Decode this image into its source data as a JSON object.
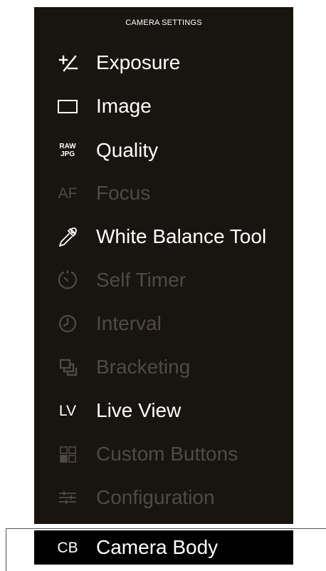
{
  "panel": {
    "title": "CAMERA SETTINGS"
  },
  "menu": [
    {
      "label": "Exposure",
      "icon": "exposure-compensation-icon",
      "icon_text": "",
      "enabled": true
    },
    {
      "label": "Image",
      "icon": "image-frame-icon",
      "icon_text": "",
      "enabled": true
    },
    {
      "label": "Quality",
      "icon": "raw-jpg-icon",
      "icon_text_top": "RAW",
      "icon_text_bottom": "JPG",
      "enabled": true
    },
    {
      "label": "Focus",
      "icon": "af-icon",
      "icon_text": "AF",
      "enabled": false
    },
    {
      "label": "White Balance Tool",
      "icon": "eyedropper-icon",
      "icon_text": "",
      "enabled": true
    },
    {
      "label": "Self Timer",
      "icon": "self-timer-icon",
      "icon_text": "",
      "enabled": false
    },
    {
      "label": "Interval",
      "icon": "interval-clock-icon",
      "icon_text": "",
      "enabled": false
    },
    {
      "label": "Bracketing",
      "icon": "bracketing-icon",
      "icon_text": "",
      "enabled": false
    },
    {
      "label": "Live View",
      "icon": "lv-icon",
      "icon_text": "LV",
      "enabled": true
    },
    {
      "label": "Custom Buttons",
      "icon": "custom-buttons-grid-icon",
      "icon_text": "",
      "enabled": false
    },
    {
      "label": "Configuration",
      "icon": "sliders-icon",
      "icon_text": "",
      "enabled": false
    }
  ],
  "bottom": {
    "label": "Camera Body",
    "icon_text": "CB",
    "icon": "cb-icon"
  },
  "colors": {
    "panel_bg": "#181410",
    "enabled_text": "#ffffff",
    "disabled_text": "#4f4a45",
    "bottom_bg": "#000000"
  }
}
